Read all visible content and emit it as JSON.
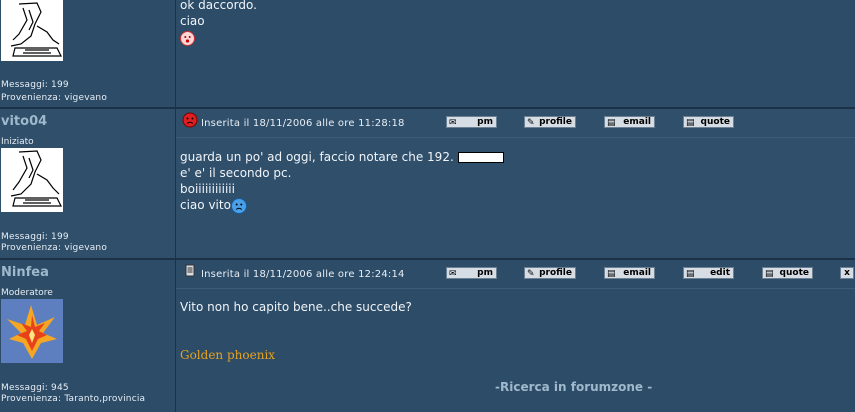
{
  "post1": {
    "body_lines": [
      "ok daccordo.",
      "ciao"
    ],
    "messages": "Messaggi: 199",
    "location": "Provenienza: vigevano"
  },
  "post2": {
    "username": "vito04",
    "rank": "Iniziato",
    "posted": "Inserita il 18/11/2006 alle ore 11:28:18",
    "buttons": [
      "pm",
      "profile",
      "email",
      "quote"
    ],
    "body_lines": [
      "guarda un po' ad oggi, faccio notare che 192.",
      "e' e' il secondo pc.",
      "boiiiiiiiiiiii",
      "ciao vito"
    ],
    "messages": "Messaggi: 199",
    "location": "Provenienza: vigevano"
  },
  "post3": {
    "username": "Ninfea",
    "rank": "Moderatore",
    "posted": "Inserita il 18/11/2006 alle ore 12:24:14",
    "buttons": [
      "pm",
      "profile",
      "email",
      "edit",
      "quote",
      "x"
    ],
    "body_lines": [
      "Vito non ho capito bene..che succede?"
    ],
    "signature": "Golden phoenix",
    "messages": "Messaggi: 945",
    "location": "Provenienza: Taranto,provincia"
  },
  "footer": {
    "link": "-Ricerca in forumzone -"
  },
  "colors": {
    "bg": "#2c4c68",
    "username": "#9fb9cc",
    "signature": "#e8a21c",
    "button": "#d6dde4"
  }
}
